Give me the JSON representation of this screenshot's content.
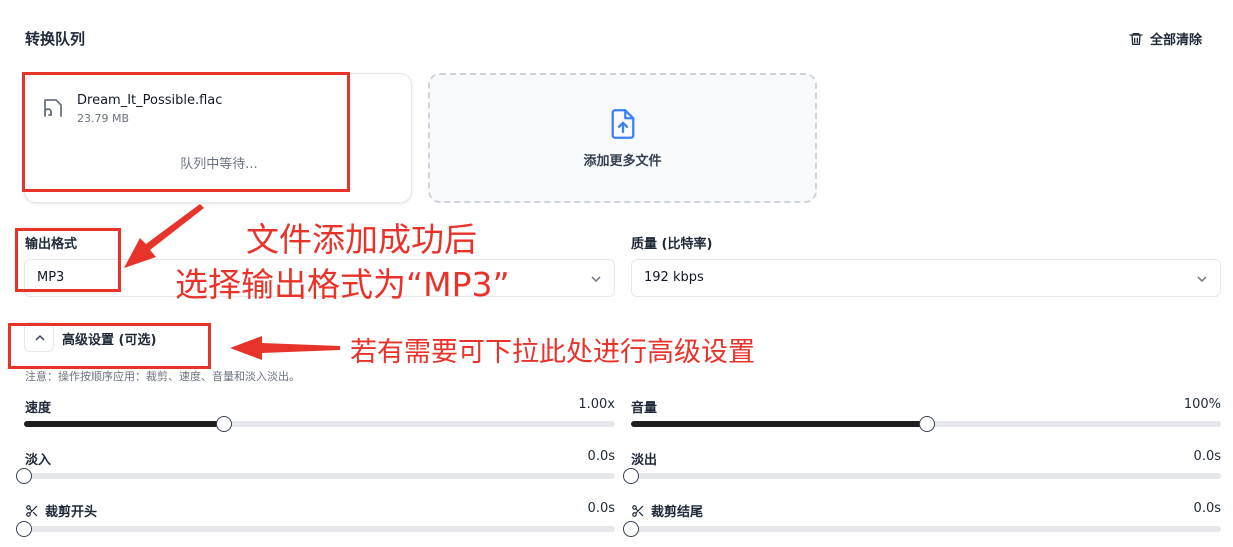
{
  "queue": {
    "title": "转换队列",
    "clear_all_label": "全部清除"
  },
  "file": {
    "name": "Dream_It_Possible.flac",
    "size": "23.79 MB",
    "status": "队列中等待..."
  },
  "add_more": {
    "label": "添加更多文件"
  },
  "output_format": {
    "label": "输出格式",
    "value": "MP3"
  },
  "quality": {
    "label": "质量 (比特率)",
    "value": "192 kbps"
  },
  "advanced": {
    "label": "高级设置 (可选)",
    "note": "注意：操作按顺序应用：裁剪、速度、音量和淡入淡出。"
  },
  "sliders": {
    "speed": {
      "label": "速度",
      "value": "1.00x",
      "fraction": 0.338
    },
    "volume": {
      "label": "音量",
      "value": "100%",
      "fraction": 0.501
    },
    "fade_in": {
      "label": "淡入",
      "value": "0.0s",
      "fraction": 0
    },
    "fade_out": {
      "label": "淡出",
      "value": "0.0s",
      "fraction": 0
    },
    "trim_start": {
      "label": "裁剪开头",
      "value": "0.0s",
      "fraction": 0
    },
    "trim_end": {
      "label": "裁剪结尾",
      "value": "0.0s",
      "fraction": 0
    }
  },
  "annotations": {
    "line1": "文件添加成功后",
    "line2": "选择输出格式为“MP3”",
    "line3": "若有需要可下拉此处进行高级设置"
  },
  "colors": {
    "annotation_red": "#e8332a",
    "accent_blue": "#3b82f6"
  }
}
